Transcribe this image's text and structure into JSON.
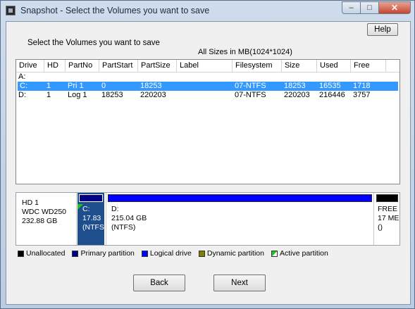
{
  "window": {
    "title": "Snapshot - Select the Volumes you want to save",
    "minimize_glyph": "–",
    "maximize_glyph": "□",
    "close_glyph": "✕"
  },
  "help_label": "Help",
  "prompt": "Select the Volumes you want to save",
  "sizes_note": "All Sizes in MB(1024*1024)",
  "columns": [
    "Drive",
    "HD",
    "PartNo",
    "PartStart",
    "PartSize",
    "Label",
    "Filesystem",
    "Size",
    "Used",
    "Free"
  ],
  "rows": [
    {
      "drive": "A:",
      "hd": "",
      "partno": "",
      "partstart": "",
      "partsize": "",
      "label": "",
      "filesystem": "",
      "size": "",
      "used": "",
      "free": ""
    },
    {
      "drive": "C:",
      "hd": "1",
      "partno": "Pri  1",
      "partstart": "0",
      "partsize": "18253",
      "label": "",
      "filesystem": "07-NTFS",
      "size": "18253",
      "used": "16535",
      "free": "1718"
    },
    {
      "drive": "D:",
      "hd": "1",
      "partno": "Log  1",
      "partstart": "18253",
      "partsize": "220203",
      "label": "",
      "filesystem": "07-NTFS",
      "size": "220203",
      "used": "216446",
      "free": "3757"
    }
  ],
  "selected_row": 1,
  "disk": {
    "name": "HD 1",
    "model": "WDC WD250",
    "capacity": "232.88 GB",
    "partitions": [
      {
        "line1": "C:",
        "line2": "17.83",
        "line3": "(NTFS",
        "color": "#000086",
        "active": true
      },
      {
        "line1": "D:",
        "line2": "215.04 GB",
        "line3": "(NTFS)",
        "color": "#0000ff",
        "active": false
      },
      {
        "line1": "FREE",
        "line2": "17 ME",
        "line3": "()",
        "color": "#000000",
        "active": false
      }
    ]
  },
  "legend": [
    {
      "label": "Unallocated",
      "color": "#000000"
    },
    {
      "label": "Primary partition",
      "color": "#000086"
    },
    {
      "label": "Logical drive",
      "color": "#0000ff"
    },
    {
      "label": "Dynamic partition",
      "color": "#808000"
    },
    {
      "label": "Active partition",
      "color": "#1ec81e",
      "icon": "active-partition-icon"
    }
  ],
  "back_label": "Back",
  "next_label": "Next"
}
